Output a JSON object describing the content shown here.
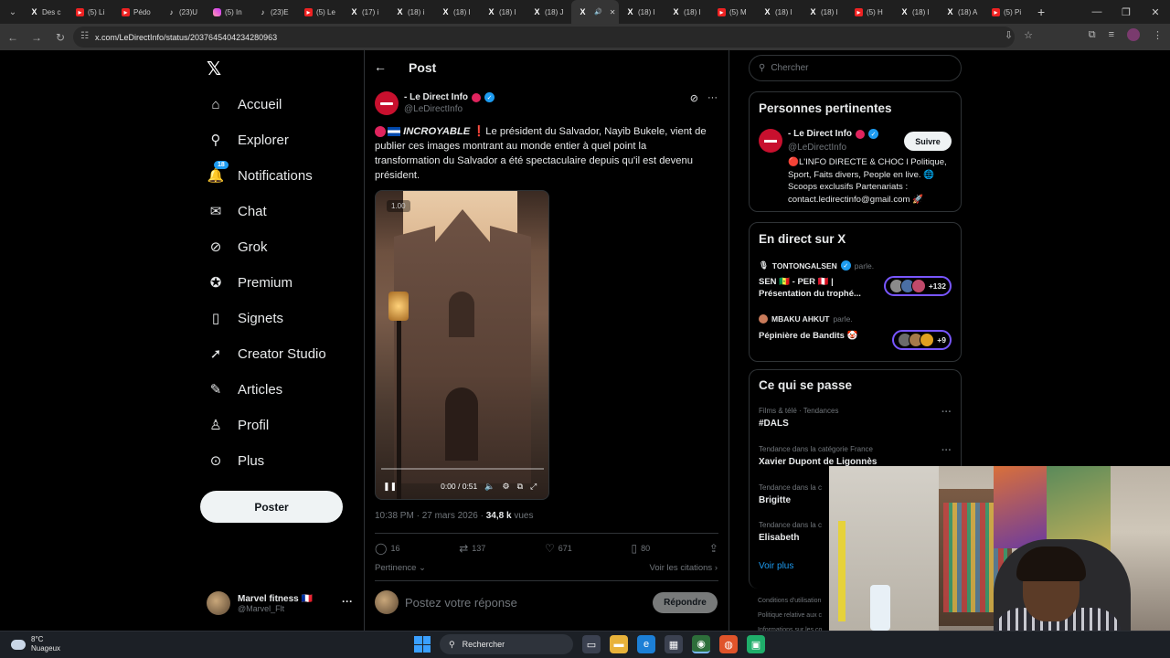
{
  "browser": {
    "tabs": [
      {
        "label": "Des c",
        "icon": "x"
      },
      {
        "label": "(5) Li",
        "icon": "youtube"
      },
      {
        "label": "Pédo",
        "icon": "youtube"
      },
      {
        "label": "(23)U",
        "icon": "tiktok"
      },
      {
        "label": "(5) In",
        "icon": "instagram"
      },
      {
        "label": "(23)E",
        "icon": "tiktok"
      },
      {
        "label": "(5) Le",
        "icon": "youtube"
      },
      {
        "label": "(17) i",
        "icon": "x"
      },
      {
        "label": "(18) i",
        "icon": "x"
      },
      {
        "label": "(18) I",
        "icon": "x"
      },
      {
        "label": "(18) I",
        "icon": "x"
      },
      {
        "label": "(18) J",
        "icon": "x"
      },
      {
        "label": "",
        "icon": "x",
        "active": true
      },
      {
        "label": "(18) I",
        "icon": "x"
      },
      {
        "label": "(18) I",
        "icon": "x"
      },
      {
        "label": "(5) M",
        "icon": "youtube"
      },
      {
        "label": "(18) I",
        "icon": "x"
      },
      {
        "label": "(18) I",
        "icon": "x"
      },
      {
        "label": "(5) H",
        "icon": "youtube"
      },
      {
        "label": "(18) I",
        "icon": "x"
      },
      {
        "label": "(18) A",
        "icon": "x"
      },
      {
        "label": "(5) Pi",
        "icon": "youtube"
      }
    ],
    "url": "x.com/LeDirectInfo/status/2037645404234280963"
  },
  "nav": {
    "items": [
      {
        "label": "Accueil",
        "icon": "home-icon",
        "glyph": "⌂"
      },
      {
        "label": "Explorer",
        "icon": "search-icon",
        "glyph": "⚲"
      },
      {
        "label": "Notifications",
        "icon": "bell-icon",
        "glyph": "🔔",
        "badge": "18"
      },
      {
        "label": "Chat",
        "icon": "mail-icon",
        "glyph": "✉"
      },
      {
        "label": "Grok",
        "icon": "grok-icon",
        "glyph": "⊘"
      },
      {
        "label": "Premium",
        "icon": "premium-icon",
        "glyph": "✪"
      },
      {
        "label": "Signets",
        "icon": "bookmark-icon",
        "glyph": "▯"
      },
      {
        "label": "Creator Studio",
        "icon": "rocket-icon",
        "glyph": "➚"
      },
      {
        "label": "Articles",
        "icon": "article-icon",
        "glyph": "✎"
      },
      {
        "label": "Profil",
        "icon": "profile-icon",
        "glyph": "♙"
      },
      {
        "label": "Plus",
        "icon": "more-icon",
        "glyph": "⊙"
      }
    ],
    "post_button": "Poster",
    "account": {
      "name": "Marvel fitness 🇫🇷",
      "handle": "@Marvel_Flt"
    }
  },
  "post": {
    "header_title": "Post",
    "author_name": "- Le Direct Info",
    "author_handle": "@LeDirectInfo",
    "text_bold": "INCROYABLE",
    "text": "❗Le président du Salvador, Nayib Bukele, vient de publier ces images montrant au monde entier à quel point la transformation du Salvador a été spectaculaire depuis qu'il est devenu président.",
    "video": {
      "timestamp_badge": "1.00",
      "time": "0:00 / 0:51"
    },
    "time": "10:38 PM · 27 mars 2026 · ",
    "views_count": "34,8 k",
    "views_label": " vues",
    "stats": {
      "replies": "16",
      "reposts": "137",
      "likes": "671",
      "bookmarks": "80"
    },
    "relevance": "Pertinence",
    "citations": "Voir les citations",
    "reply_placeholder": "Postez votre réponse",
    "reply_button": "Répondre"
  },
  "right": {
    "search_placeholder": "Chercher",
    "relevant_title": "Personnes pertinentes",
    "relevant": {
      "name": "- Le Direct Info",
      "handle": "@LeDirectInfo",
      "follow": "Suivre",
      "bio": "🔴L'INFO DIRECTE & CHOC l Politique, Sport, Faits divers, People en live. 🌐 Scoops exclusifs Partenariats : contact.ledirectinfo@gmail.com 🚀"
    },
    "live_title": "En direct sur X",
    "live": [
      {
        "host": "TONTONGALSEN",
        "speaks": "parle.",
        "title": "SEN 🇸🇳 - PER 🇵🇪 | Présentation du trophé...",
        "count": "+132"
      },
      {
        "host": "MBAKU AHKUT",
        "speaks": "parle.",
        "title": "Pépinière de Bandits 🤡",
        "count": "+9"
      }
    ],
    "trends_title": "Ce qui se passe",
    "trends": [
      {
        "category": "Films & télé · Tendances",
        "name": "#DALS"
      },
      {
        "category": "Tendance dans la catégorie France",
        "name": "Xavier Dupont de Ligonnès"
      },
      {
        "category": "Tendance dans la c",
        "name": "Brigitte"
      },
      {
        "category": "Tendance dans la c",
        "name": "Elisabeth"
      }
    ],
    "see_more": "Voir plus",
    "footer": [
      "Conditions d'utilisation",
      "Politique relative aux c",
      "Informations sur les co"
    ]
  },
  "taskbar": {
    "temp": "8°C",
    "weather": "Nuageux",
    "search": "Rechercher"
  }
}
